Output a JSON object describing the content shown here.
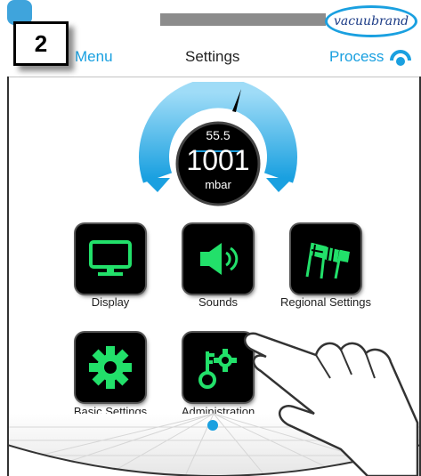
{
  "step_badge": "2",
  "header": {
    "brand": "vacuubrand"
  },
  "nav": {
    "menu_label": "Menu",
    "title": "Settings",
    "process_label": "Process"
  },
  "gauge": {
    "setpoint": "55.5",
    "value": "1001",
    "unit": "mbar"
  },
  "tiles": [
    {
      "label": "Display",
      "icon": "monitor-icon"
    },
    {
      "label": "Sounds",
      "icon": "speaker-icon"
    },
    {
      "label": "Regional Settings",
      "icon": "flags-icon"
    },
    {
      "label": "Basic Settings",
      "icon": "gear-icon"
    },
    {
      "label": "Administration",
      "icon": "key-gear-icon"
    }
  ],
  "pagination": {
    "current_page": 1
  },
  "colors": {
    "accent": "#1aa0e0",
    "tile_green": "#22e06a",
    "tile_bg": "#000000"
  }
}
